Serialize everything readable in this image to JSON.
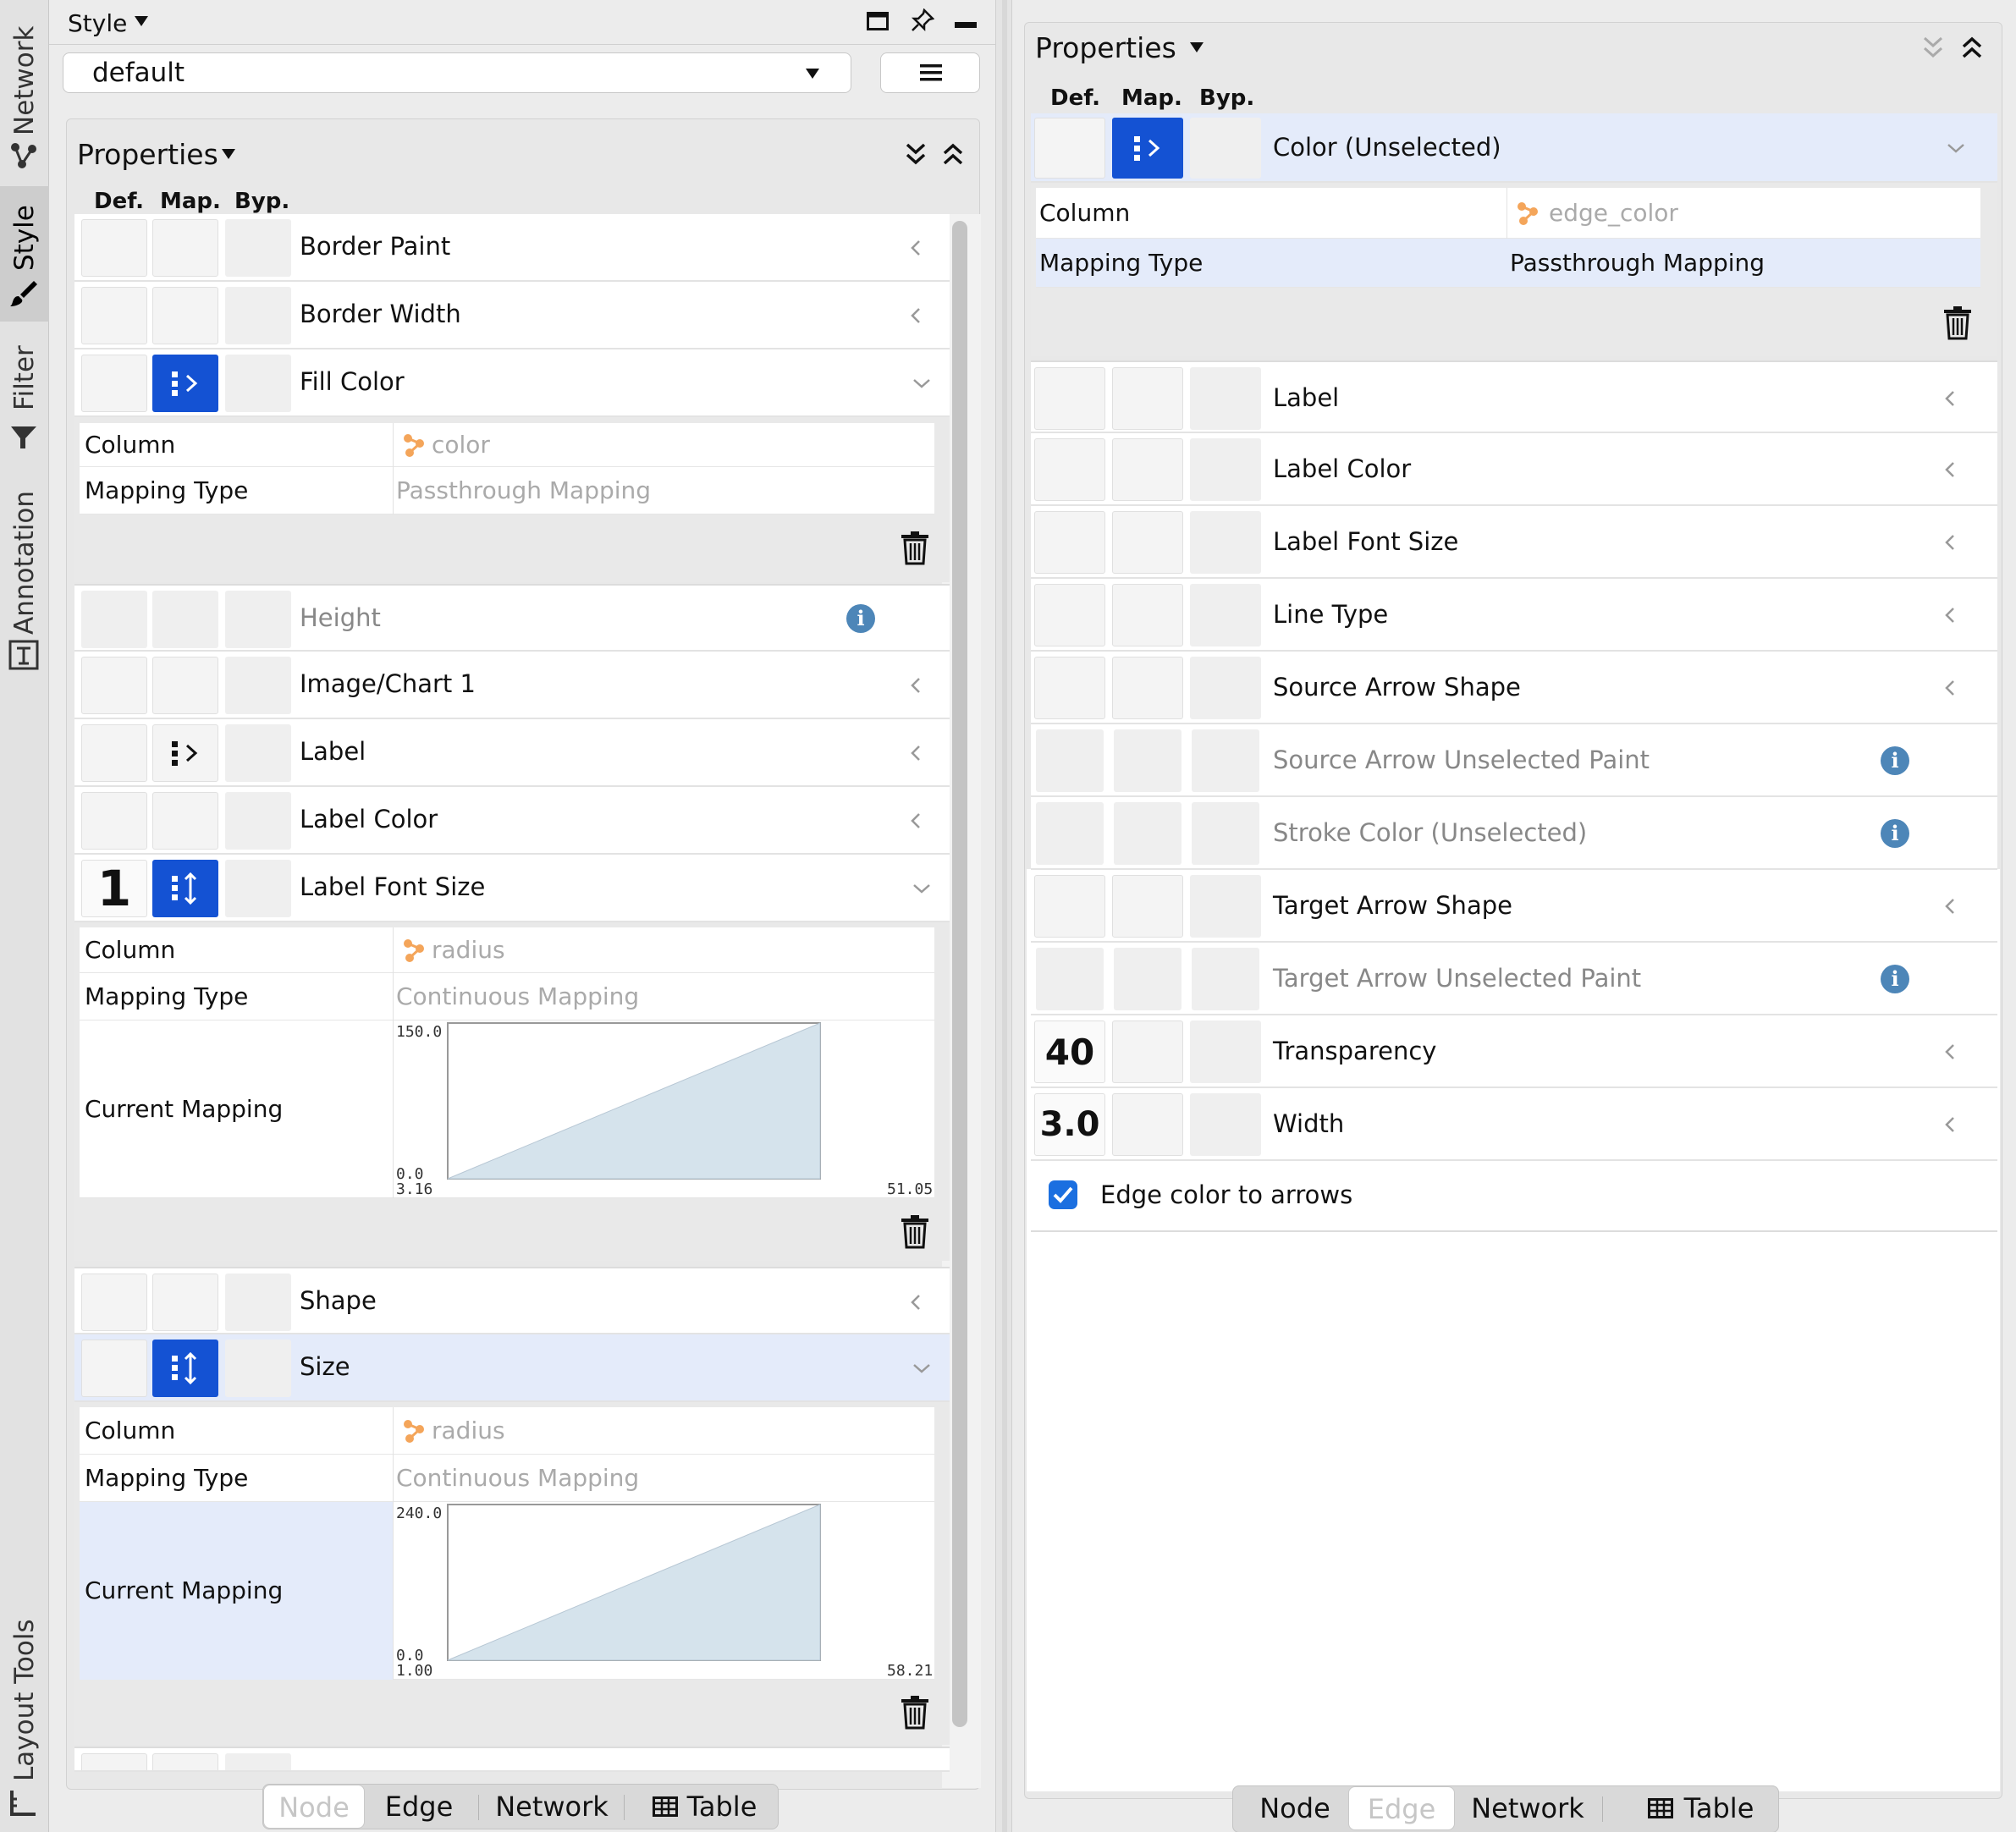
{
  "vertical_tabs": [
    "Network",
    "Style",
    "Filter",
    "Annotation",
    "Layout Tools"
  ],
  "left": {
    "title": "Style",
    "style_name": "default",
    "properties_header": "Properties",
    "col_headers": {
      "def": "Def.",
      "map": "Map.",
      "byp": "Byp."
    },
    "props": {
      "border_paint": "Border Paint",
      "border_width": "Border Width",
      "fill_color": "Fill Color",
      "height": "Height",
      "image_chart_1": "Image/Chart 1",
      "label": "Label",
      "label_color": "Label Color",
      "label_font_size": "Label Font Size",
      "label_font_size_default": "1",
      "shape": "Shape",
      "size": "Size"
    },
    "mapping_labels": {
      "column": "Column",
      "mapping_type": "Mapping Type",
      "current_mapping": "Current Mapping"
    },
    "fill_color_mapping": {
      "column": "color",
      "type": "Passthrough Mapping"
    },
    "label_font_size_mapping": {
      "column": "radius",
      "type": "Continuous Mapping",
      "y_max": "150.0",
      "y_min": "0.0",
      "x_min": "3.16",
      "x_max": "51.05"
    },
    "size_mapping": {
      "column": "radius",
      "type": "Continuous Mapping",
      "y_max": "240.0",
      "y_min": "0.0",
      "x_min": "1.00",
      "x_max": "58.21"
    },
    "bottom_tabs": [
      "Node",
      "Edge",
      "Network",
      "Table"
    ],
    "active_tab": "Node"
  },
  "right": {
    "properties_header": "Properties",
    "col_headers": {
      "def": "Def.",
      "map": "Map.",
      "byp": "Byp."
    },
    "color_unselected": {
      "label": "Color (Unselected)",
      "column": "edge_color",
      "type": "Passthrough Mapping"
    },
    "mapping_labels": {
      "column": "Column",
      "mapping_type": "Mapping Type"
    },
    "props": {
      "label": "Label",
      "label_color": "Label Color",
      "label_font_size": "Label Font Size",
      "line_type": "Line Type",
      "source_arrow_shape": "Source Arrow Shape",
      "source_arrow_unselected_paint": "Source Arrow Unselected Paint",
      "stroke_color_unselected": "Stroke Color (Unselected)",
      "target_arrow_shape": "Target Arrow Shape",
      "target_arrow_unselected_paint": "Target Arrow Unselected Paint",
      "transparency": "Transparency",
      "transparency_default": "40",
      "width": "Width",
      "width_default": "3.0"
    },
    "edge_color_to_arrows": "Edge color to arrows",
    "edge_color_to_arrows_checked": true,
    "bottom_tabs": [
      "Node",
      "Edge",
      "Network",
      "Table"
    ],
    "active_tab": "Edge"
  },
  "colors": {
    "accent": "#1452d3",
    "selected_row": "#e4ebfa",
    "mapping_fill": "#d5e3ec",
    "info": "#4d86b8",
    "column_icon": "#f4a55a"
  }
}
